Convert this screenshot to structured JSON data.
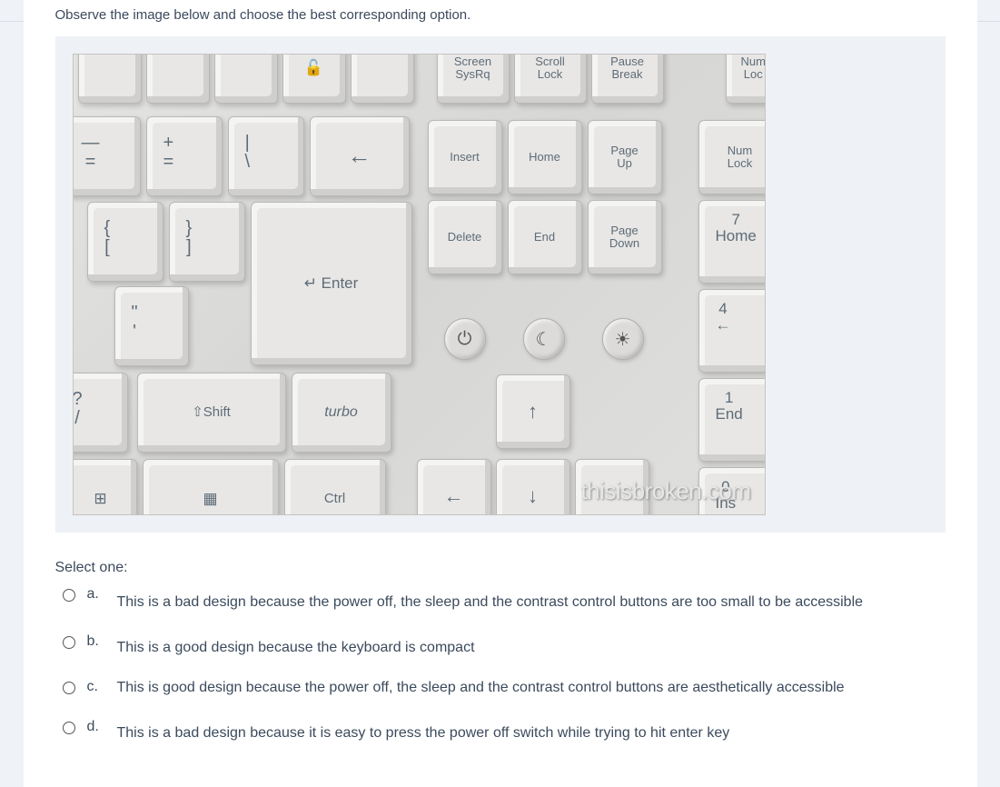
{
  "question": {
    "prompt": "Observe the image below and choose the best corresponding option.",
    "select_one": "Select one:",
    "options": [
      {
        "letter": "a.",
        "text": "This is a bad design because the power off, the sleep and the contrast control buttons are too small to be accessible"
      },
      {
        "letter": "b.",
        "text": "This is a good design because the keyboard is compact"
      },
      {
        "letter": "c.",
        "text": "This is good design because the power off, the sleep and the contrast control buttons are aesthetically accessible"
      },
      {
        "letter": "d.",
        "text": "This is a bad design because it is easy to press the power off switch while trying to hit enter key"
      }
    ]
  },
  "image": {
    "watermark": "thisisbroken.com",
    "keys": {
      "r1_screen": "Screen\nSysRq",
      "r1_scroll": "Scroll\nLock",
      "r1_pause": "Pause\nBreak",
      "r1_numlock_clip": "Num\nLoc",
      "r2_minus_eq": "—\n=",
      "r2_plus_eq": "+\n=",
      "r2_bar_slash": "|\n\\",
      "r2_back_arrow": "←",
      "r2_insert": "Insert",
      "r2_home": "Home",
      "r2_pgup": "Page\nUp",
      "r2_numlock": "Num\nLock",
      "r3_brace_l": "{\n[",
      "r3_brace_r": "}\n]",
      "r3_delete": "Delete",
      "r3_end": "End",
      "r3_pgdn": "Page\nDown",
      "r3_7home": "7\nHome",
      "r4_apos": "\"\n'",
      "r4_enter": "↵  Enter",
      "r4_4left": "4\n←",
      "r5_qslash": "?\n/",
      "r5_shift": "⇧Shift",
      "r5_turbo": "turbo",
      "r5_uparrow": "↑",
      "r5_1end": "1\nEnd",
      "r6_ctrl": "Ctrl",
      "r6_left": "←",
      "r6_down": "↓",
      "r6_0ins": "0\nIns",
      "circ_power": "⏻",
      "circ_sleep": "☾",
      "circ_bright": "☀"
    }
  }
}
